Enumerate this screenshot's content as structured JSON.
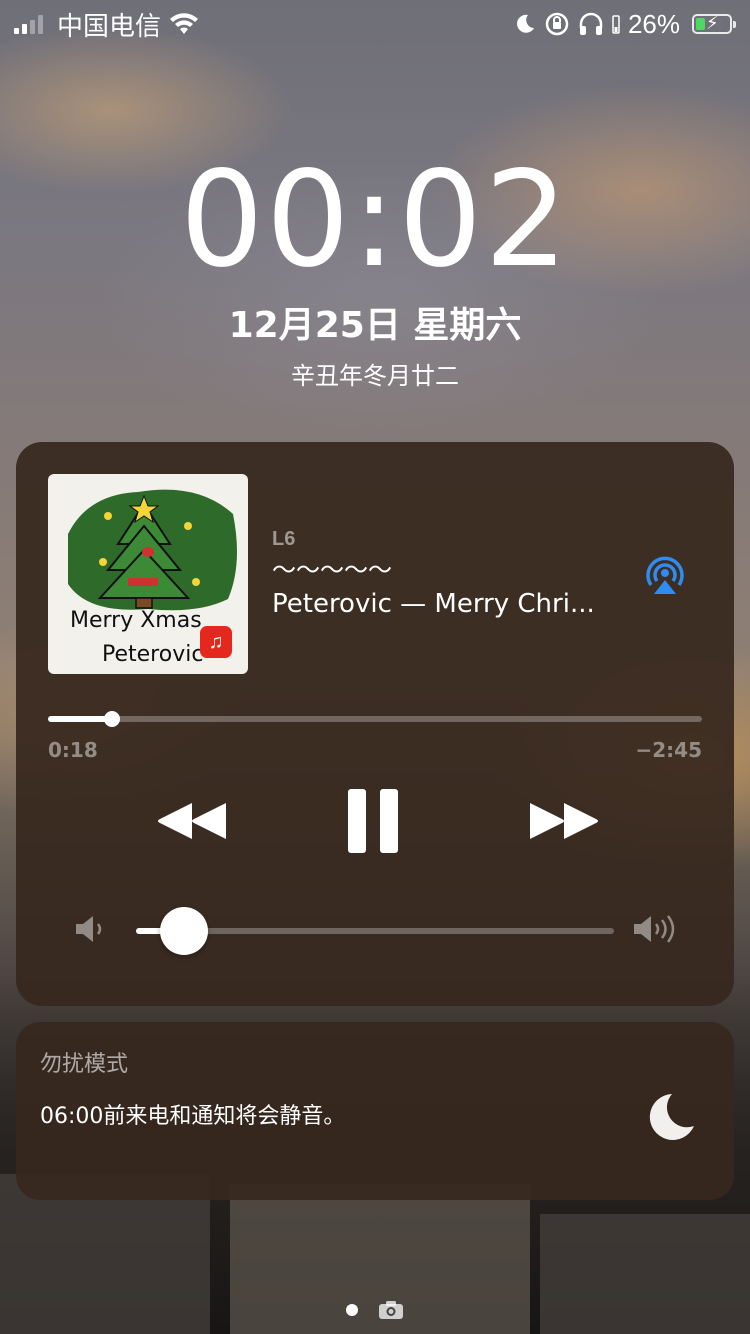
{
  "status_bar": {
    "carrier": "中国电信",
    "battery_percent": "26%",
    "battery_level": 0.26,
    "icons": [
      "signal-icon",
      "wifi-icon",
      "moon-icon",
      "rotation-lock-icon",
      "headphones-icon",
      "battery-charging-icon"
    ]
  },
  "lock_screen": {
    "time": "00:02",
    "date": "12月25日 星期六",
    "lunar_date": "辛丑年冬月廿二"
  },
  "now_playing": {
    "artwork": {
      "line1": "Merry  Xmas",
      "line2": "Peterovic",
      "app_badge_icon": "netease-music-icon"
    },
    "device": "L6",
    "title_line": "～～～～～",
    "track_line": "Peterovic — Merry Chri...",
    "elapsed": "0:18",
    "remaining": "−2:45",
    "progress_fraction": 0.098,
    "volume_fraction": 0.1,
    "controls": [
      "rewind-button",
      "pause-button",
      "fast-forward-button"
    ],
    "accent_color": "#2f8cf0"
  },
  "dnd": {
    "title": "勿扰模式",
    "message": "06:00前来电和通知将会静音。",
    "icon": "moon-icon"
  },
  "pager": {
    "icons": [
      "page-dot",
      "camera-icon"
    ]
  }
}
